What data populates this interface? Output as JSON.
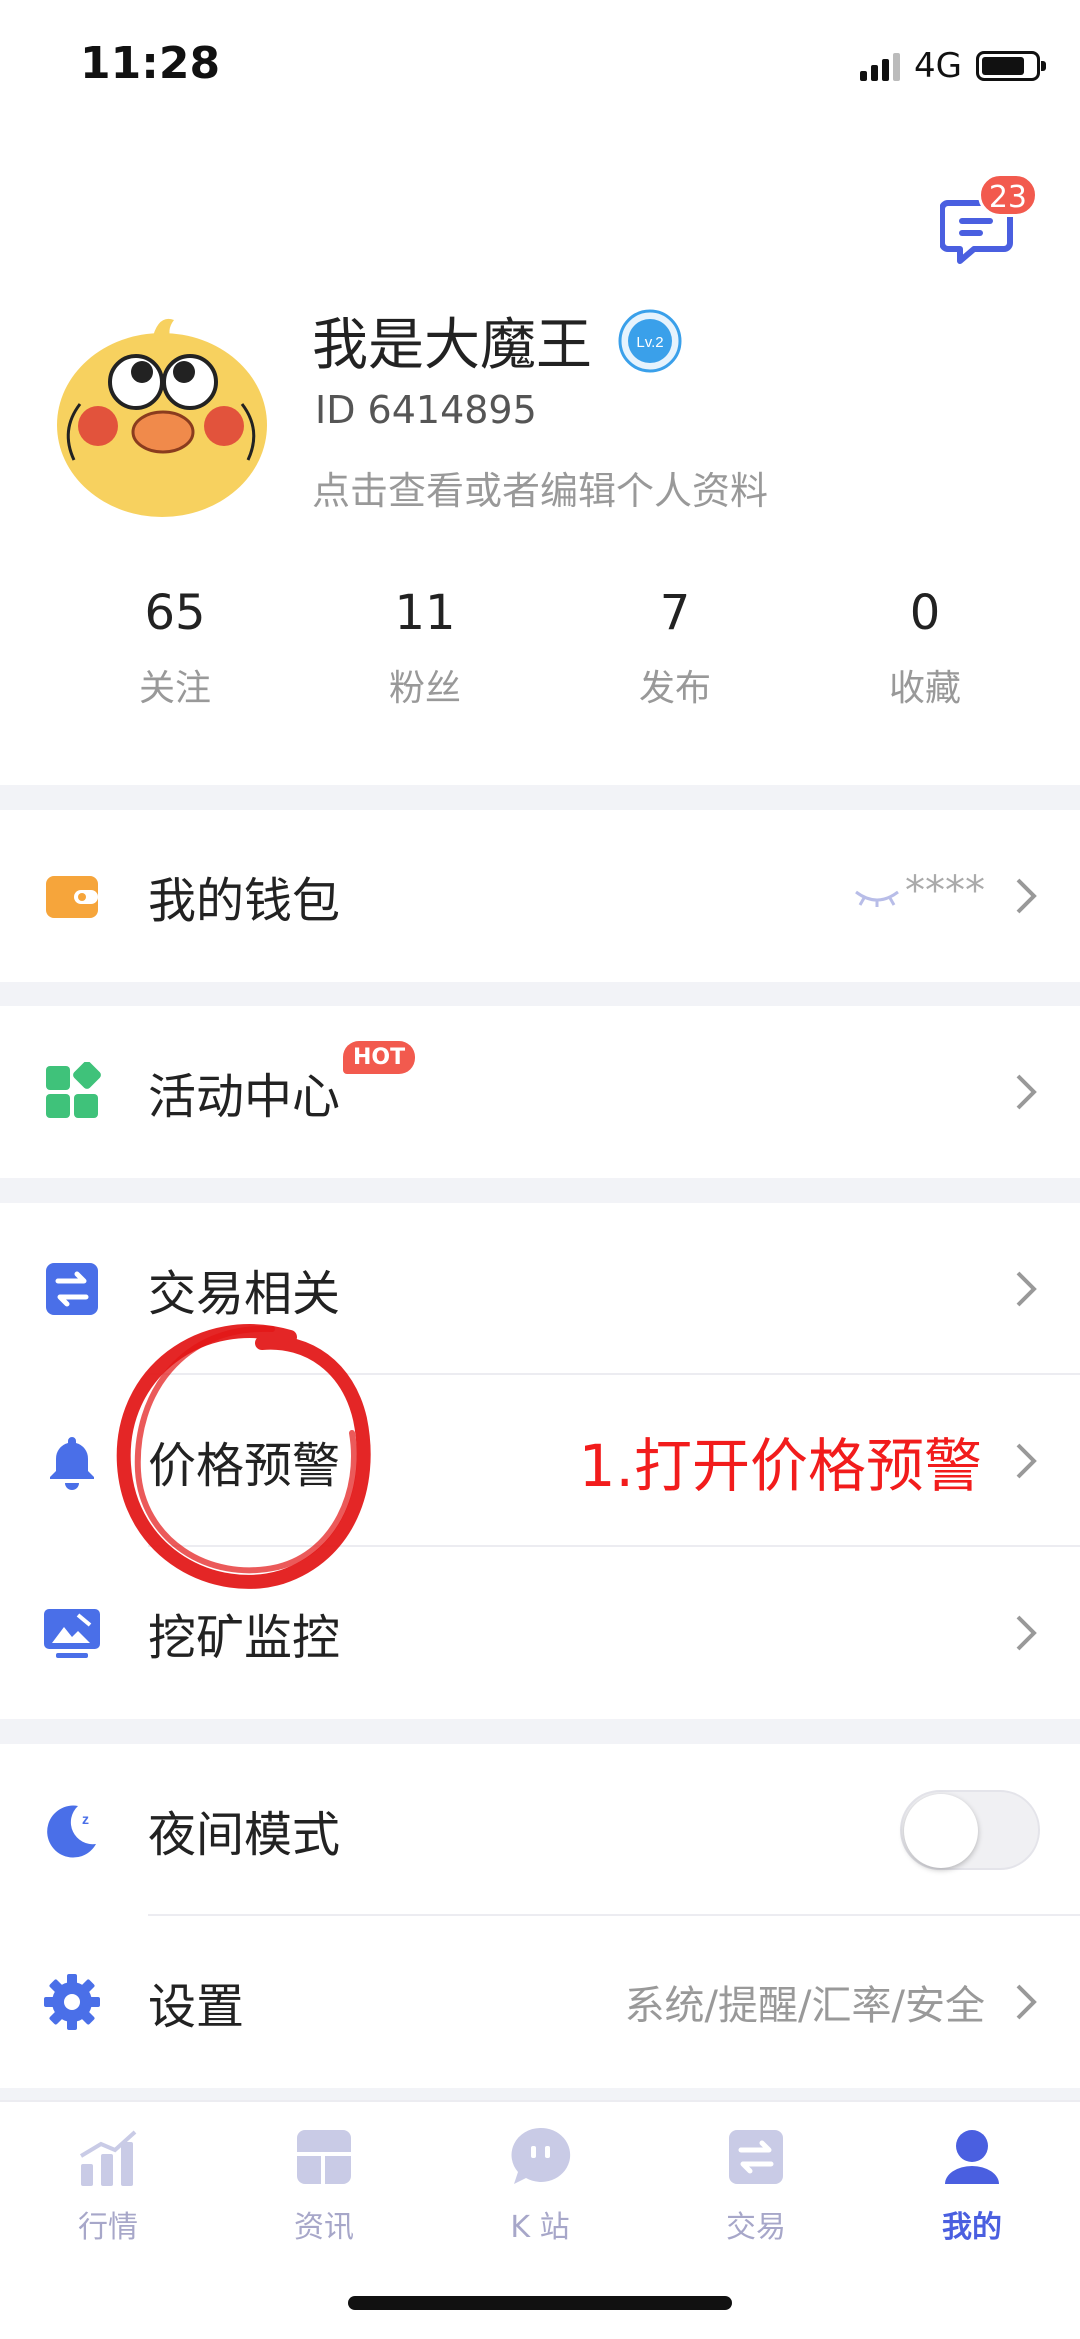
{
  "status_bar": {
    "time": "11:28",
    "network": "4G"
  },
  "header": {
    "message_badge_count": "23"
  },
  "profile": {
    "name": "我是大魔王",
    "level_badge": "Lv.2",
    "id_text": "ID 6414895",
    "edit_hint": "点击查看或者编辑个人资料",
    "stats": [
      {
        "value": "65",
        "label": "关注"
      },
      {
        "value": "11",
        "label": "粉丝"
      },
      {
        "value": "7",
        "label": "发布"
      },
      {
        "value": "0",
        "label": "收藏"
      }
    ]
  },
  "menu": {
    "wallet": {
      "label": "我的钱包",
      "masked_balance": "****"
    },
    "activity": {
      "label": "活动中心",
      "badge": "HOT"
    },
    "trade": {
      "label": "交易相关"
    },
    "price_alert": {
      "label": "价格预警",
      "annotation": "1.打开价格预警"
    },
    "mining": {
      "label": "挖矿监控"
    },
    "night_mode": {
      "label": "夜间模式",
      "enabled": false
    },
    "settings": {
      "label": "设置",
      "subtitle": "系统/提醒/汇率/安全"
    }
  },
  "tabbar": {
    "items": [
      {
        "label": "行情",
        "icon": "chart-icon"
      },
      {
        "label": "资讯",
        "icon": "news-icon"
      },
      {
        "label": "K 站",
        "icon": "community-icon"
      },
      {
        "label": "交易",
        "icon": "trade-icon"
      },
      {
        "label": "我的",
        "icon": "user-icon",
        "active": true
      }
    ]
  },
  "colors": {
    "accent": "#4a5fe0",
    "badge_red": "#f25a4e",
    "annotation_red": "#f21c1c",
    "tab_inactive": "#a7a7c9"
  }
}
